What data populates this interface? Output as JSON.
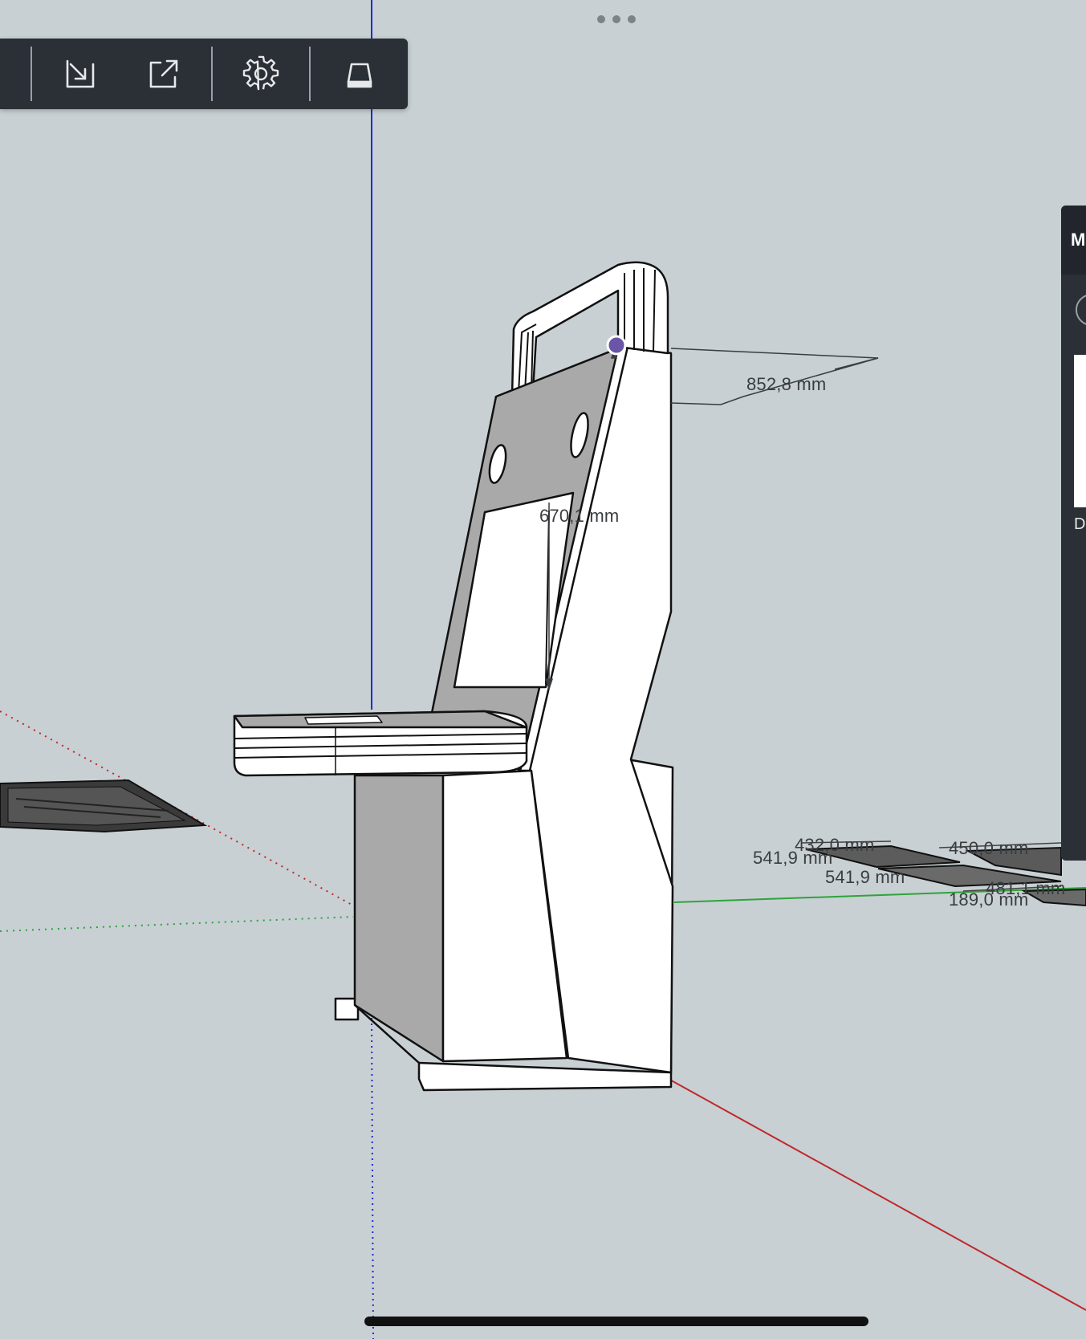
{
  "toolbar": {
    "buttons": [
      {
        "name": "import-button",
        "icon": "import-arrow-icon"
      },
      {
        "name": "export-button",
        "icon": "export-share-icon"
      },
      {
        "name": "settings-button",
        "icon": "gear-icon"
      },
      {
        "name": "display-mode-button",
        "icon": "display-mode-icon"
      }
    ]
  },
  "dimensions": {
    "depth_top": "852,8 mm",
    "screen_height": "670,1 mm",
    "part_a_width": "432,0 mm",
    "part_a_height": "541,9 mm",
    "part_b_height": "541,9 mm",
    "part_c_width": "450,0 mm",
    "part_c_height": "481,1 mm",
    "part_d_height": "189,0 mm"
  },
  "side_panel": {
    "title": "M",
    "item_label": "D"
  },
  "colors": {
    "background": "#c8d0d3",
    "toolbar": "#2b2f36",
    "axis_blue": "#1e2bd6",
    "axis_green": "#2fa33a",
    "axis_red": "#c0262a",
    "panel_shade": "#a9a9a9",
    "inference_point": "#6a55a8"
  }
}
